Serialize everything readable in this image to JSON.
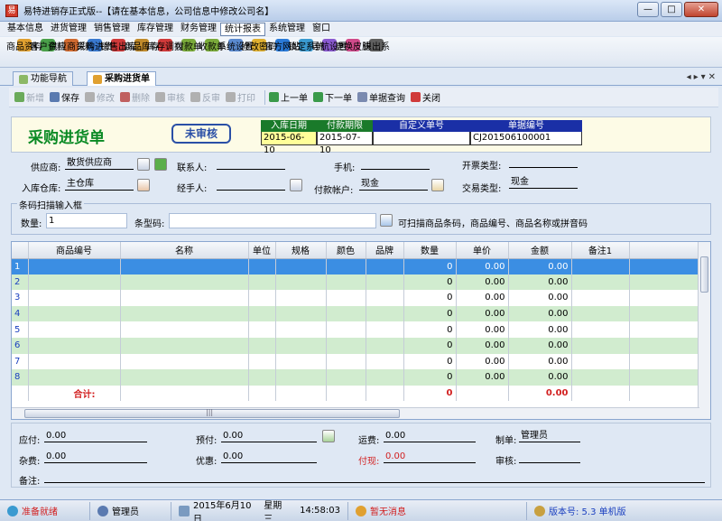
{
  "window": {
    "title": "易特进销存正式版--【请在基本信息，公司信息中修改公司名】",
    "app_icon": "易",
    "buttons": [
      "—",
      "□",
      "✕"
    ]
  },
  "menu": [
    "基本信息",
    "进货管理",
    "销售管理",
    "库存管理",
    "财务管理",
    "统计报表",
    "系统管理",
    "窗口"
  ],
  "menu_active": "统计报表",
  "toolbar": [
    {
      "label": "商品资料",
      "icon": "product-icon",
      "color": "#e0a030"
    },
    {
      "label": "客户资料",
      "icon": "customer-icon",
      "color": "#4aa04a"
    },
    {
      "label": "供应商资料",
      "icon": "supplier-icon",
      "color": "#d06a30"
    },
    {
      "label": "采购进货",
      "icon": "purchase-icon",
      "color": "#3a7ad0"
    },
    {
      "label": "销售出库",
      "icon": "sales-icon",
      "color": "#d03a3a"
    },
    {
      "label": "商品库存",
      "icon": "stock-icon",
      "color": "#c08a2a"
    },
    {
      "label": "库存调拨",
      "icon": "transfer-icon",
      "color": "#d03a3a"
    },
    {
      "label": "付款单",
      "icon": "payment-icon",
      "color": "#7aaa3a"
    },
    {
      "label": "收款单",
      "icon": "receipt-icon",
      "color": "#7aaa3a"
    },
    {
      "label": "系统设置",
      "icon": "settings-icon",
      "color": "#5a8ad0"
    },
    {
      "label": "修改密码",
      "icon": "key-icon",
      "color": "#e0b030"
    },
    {
      "label": "官方网站",
      "icon": "ie-icon",
      "color": "#2a7ad8"
    },
    {
      "label": "锁定系统",
      "icon": "lock-icon",
      "color": "#3a9ad0"
    },
    {
      "label": "导航设置",
      "icon": "nav-icon",
      "color": "#8a5ad0"
    },
    {
      "label": "更换皮肤",
      "icon": "skin-icon",
      "color": "#d04a8a"
    },
    {
      "label": "退出系",
      "icon": "exit-icon",
      "color": "#606060"
    }
  ],
  "tabs": [
    {
      "label": "功能导航"
    },
    {
      "label": "采购进货单"
    }
  ],
  "doc_toolbar": [
    {
      "label": "新增",
      "enabled": false,
      "icon": "add-icon"
    },
    {
      "label": "保存",
      "enabled": true,
      "icon": "save-icon"
    },
    {
      "label": "修改",
      "enabled": false,
      "icon": "edit-icon"
    },
    {
      "label": "删除",
      "enabled": false,
      "icon": "delete-icon"
    },
    {
      "label": "审核",
      "enabled": false,
      "icon": "approve-icon"
    },
    {
      "label": "反审",
      "enabled": false,
      "icon": "unapprove-icon"
    },
    {
      "label": "打印",
      "enabled": false,
      "icon": "print-icon"
    },
    {
      "label": "上一单",
      "enabled": true,
      "icon": "prev-icon"
    },
    {
      "label": "下一单",
      "enabled": true,
      "icon": "next-icon"
    },
    {
      "label": "单据查询",
      "enabled": true,
      "icon": "query-icon"
    },
    {
      "label": "关闭",
      "enabled": true,
      "icon": "close-icon"
    }
  ],
  "header": {
    "title": "采购进货单",
    "stamp": "未审核",
    "in_date_label": "入库日期",
    "in_date": "2015-06-10",
    "pay_deadline_label": "付款期限",
    "pay_deadline": "2015-07-10",
    "custom_no_label": "自定义单号",
    "custom_no": "",
    "doc_no_label": "单据编号",
    "doc_no": "CJ201506100001"
  },
  "form": {
    "supplier_label": "供应商:",
    "supplier": "散货供应商",
    "contact_label": "联系人:",
    "contact": "",
    "phone_label": "手机:",
    "phone": "",
    "invoice_label": "开票类型:",
    "invoice": "",
    "warehouse_label": "入库仓库:",
    "warehouse": "主仓库",
    "handler_label": "经手人:",
    "handler": "",
    "pay_account_label": "付款帐户:",
    "pay_account": "现金",
    "trade_label": "交易类型:",
    "trade": "现金"
  },
  "scan": {
    "group_title": "条码扫描输入框",
    "qty_label": "数量:",
    "qty": "1",
    "barcode_label": "条型码:",
    "barcode": "",
    "hint": "可扫描商品条码，商品编号、商品名称或拼音码"
  },
  "grid": {
    "columns": [
      "商品编号",
      "名称",
      "单位",
      "规格",
      "颜色",
      "品牌",
      "数量",
      "单价",
      "金额",
      "备注1"
    ],
    "rows": [
      {
        "n": "1",
        "qty": "0",
        "price": "0.00",
        "amount": "0.00"
      },
      {
        "n": "2",
        "qty": "0",
        "price": "0.00",
        "amount": "0.00"
      },
      {
        "n": "3",
        "qty": "0",
        "price": "0.00",
        "amount": "0.00"
      },
      {
        "n": "4",
        "qty": "0",
        "price": "0.00",
        "amount": "0.00"
      },
      {
        "n": "5",
        "qty": "0",
        "price": "0.00",
        "amount": "0.00"
      },
      {
        "n": "6",
        "qty": "0",
        "price": "0.00",
        "amount": "0.00"
      },
      {
        "n": "7",
        "qty": "0",
        "price": "0.00",
        "amount": "0.00"
      },
      {
        "n": "8",
        "qty": "0",
        "price": "0.00",
        "amount": "0.00"
      }
    ],
    "total_label": "合计:",
    "total_qty": "0",
    "total_amount": "0.00",
    "scroll_hint": "|||"
  },
  "footer": {
    "payable_label": "应付:",
    "payable": "0.00",
    "prepaid_label": "预付:",
    "prepaid": "0.00",
    "freight_label": "运费:",
    "freight": "0.00",
    "maker_label": "制单:",
    "maker": "管理员",
    "misc_label": "杂费:",
    "misc": "0.00",
    "discount_label": "优惠:",
    "discount": "0.00",
    "cash_label": "付现:",
    "cash": "0.00",
    "reviewer_label": "审核:",
    "reviewer": "",
    "remark_label": "备注:",
    "remark": ""
  },
  "status": {
    "ready": "准备就绪",
    "user": "管理员",
    "date": "2015年6月10日",
    "weekday": "星期三",
    "time": "14:58:03",
    "msg": "暂无消息",
    "version": "版本号: 5.3 单机版"
  }
}
